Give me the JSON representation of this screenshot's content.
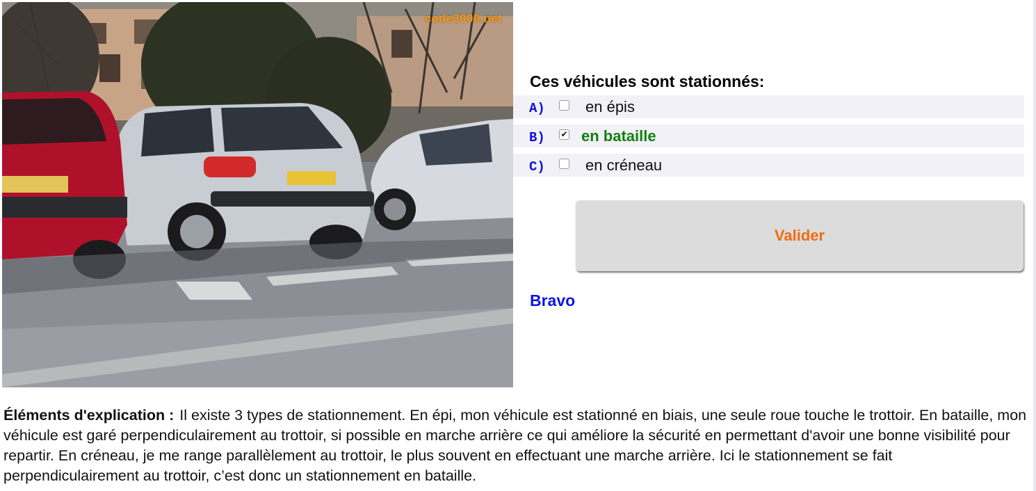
{
  "photo": {
    "watermark": "code3000.net"
  },
  "question": {
    "title": "Ces véhicules sont stationnés:"
  },
  "answers": [
    {
      "letter": "A)",
      "label": "en épis",
      "checked": false
    },
    {
      "letter": "B)",
      "label": "en bataille",
      "checked": true
    },
    {
      "letter": "C)",
      "label": "en créneau",
      "checked": false
    }
  ],
  "checkmark": "✔",
  "validate_button": "Valider",
  "result": "Bravo",
  "explanation": {
    "heading": "Éléments d'explication :",
    "text": "Il existe 3 types de stationnement. En épi, mon véhicule est stationné en biais, une seule roue touche le trottoir. En bataille, mon véhicule est garé perpendiculairement au trottoir, si possible en marche arrière ce qui améliore la sécurité en permettant d'avoir une bonne visibilité pour repartir. En créneau, je me range parallèlement au trottoir, le plus souvent en effectuant une marche arrière. Ici le stationnement se fait perpendiculairement au trottoir, c’est donc un stationnement en bataille."
  },
  "colors": {
    "answer_letter": "#1010e0",
    "correct_answer": "#11800f",
    "validate_text": "#f26b0f",
    "result_text": "#0a16e6",
    "watermark": "#f29a18"
  }
}
